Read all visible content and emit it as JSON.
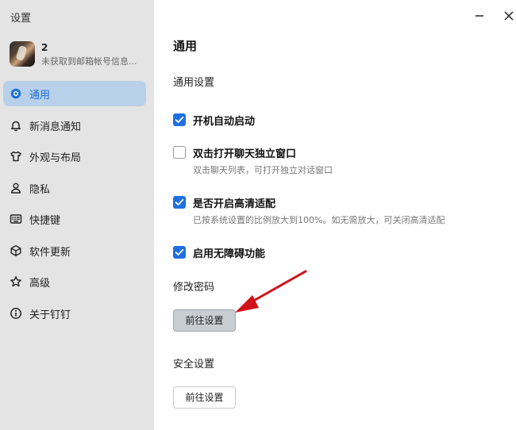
{
  "app": {
    "title": "设置"
  },
  "profile": {
    "name": "2",
    "subtitle": "未获取到邮箱帐号信息..."
  },
  "sidebar": {
    "items": [
      {
        "label": "通用",
        "icon": "gear-icon",
        "active": true
      },
      {
        "label": "新消息通知",
        "icon": "bell-icon"
      },
      {
        "label": "外观与布局",
        "icon": "shirt-icon"
      },
      {
        "label": "隐私",
        "icon": "person-icon"
      },
      {
        "label": "快捷键",
        "icon": "keyboard-icon"
      },
      {
        "label": "软件更新",
        "icon": "cube-icon"
      },
      {
        "label": "高级",
        "icon": "star-icon"
      },
      {
        "label": "关于钉钉",
        "icon": "info-icon"
      }
    ]
  },
  "window_controls": {
    "minimize_icon": "minimize-icon",
    "close_icon": "close-icon"
  },
  "main": {
    "title": "通用",
    "general_heading": "通用设置",
    "options": [
      {
        "label": "开机自动启动",
        "checked": true,
        "desc": ""
      },
      {
        "label": "双击打开聊天独立窗口",
        "checked": false,
        "desc": "双击聊天列表，可打开独立对话窗口"
      },
      {
        "label": "是否开启高清适配",
        "checked": true,
        "desc": "已按系统设置的比例放大到100%。如无需放大，可关闭高清适配"
      },
      {
        "label": "启用无障碍功能",
        "checked": true,
        "desc": ""
      }
    ],
    "password": {
      "heading": "修改密码",
      "button": "前往设置"
    },
    "security": {
      "heading": "安全设置",
      "button": "前往设置"
    }
  },
  "colors": {
    "accent": "#1f6fe0",
    "active_nav_bg": "#b9d0ea",
    "sidebar_bg": "#e4e4e4",
    "arrow": "#d0121b"
  }
}
